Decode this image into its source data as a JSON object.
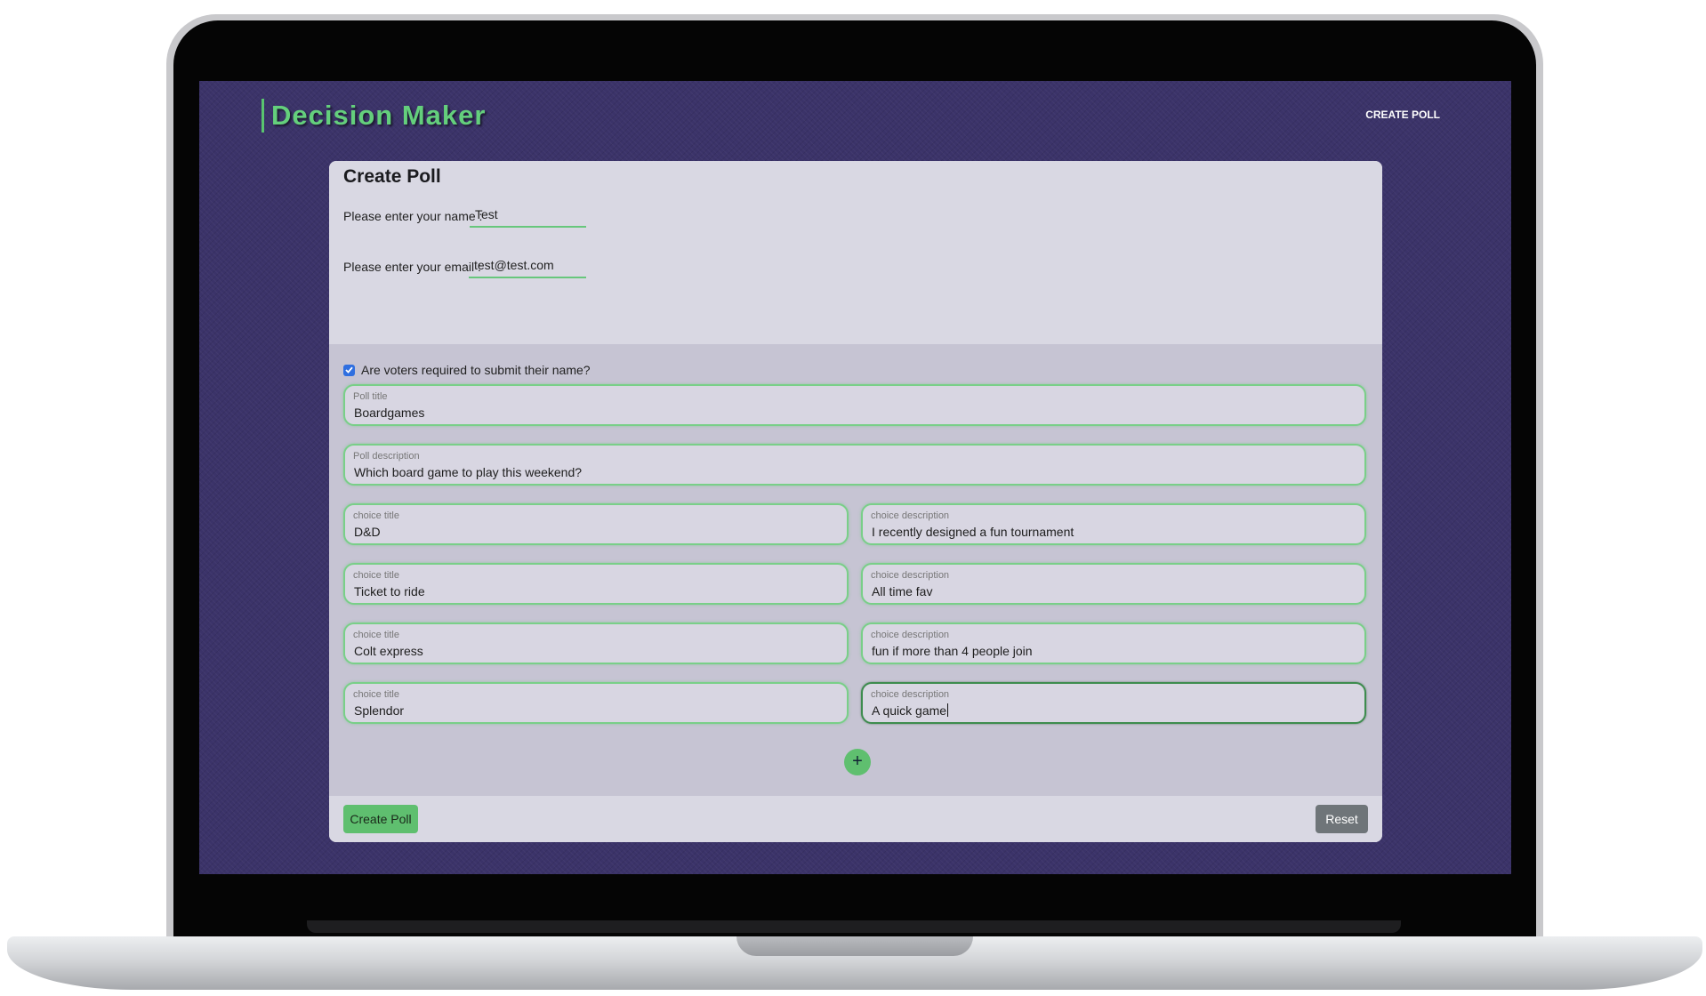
{
  "header": {
    "brand": "Decision Maker",
    "nav_create_poll": "CREATE POLL"
  },
  "form": {
    "title": "Create Poll",
    "name_label": "Please enter your name :",
    "name_value": "Test",
    "email_label": "Please enter your email :",
    "email_value": "test@test.com",
    "require_names_label": "Are voters required to submit their name?",
    "require_names_checked": true,
    "poll_title_label": "Poll title",
    "poll_title_value": "Boardgames",
    "poll_description_label": "Poll description",
    "poll_description_value": "Which board game to play this weekend?",
    "choices": [
      {
        "title_label": "choice title",
        "title": "D&D",
        "description_label": "choice description",
        "description": "I recently designed a fun tournament"
      },
      {
        "title_label": "choice title",
        "title": "Ticket to ride",
        "description_label": "choice description",
        "description": "All time fav"
      },
      {
        "title_label": "choice title",
        "title": "Colt express",
        "description_label": "choice description",
        "description": "fun if more than 4 people join"
      },
      {
        "title_label": "choice title",
        "title": "Splendor",
        "description_label": "choice description",
        "description": "A quick game"
      }
    ],
    "add_choice_symbol": "+",
    "create_button": "Create Poll",
    "reset_button": "Reset"
  },
  "colors": {
    "accent_green": "#5fbf6f",
    "background_purple": "#3b3369",
    "reset_gray": "#6f7579"
  }
}
